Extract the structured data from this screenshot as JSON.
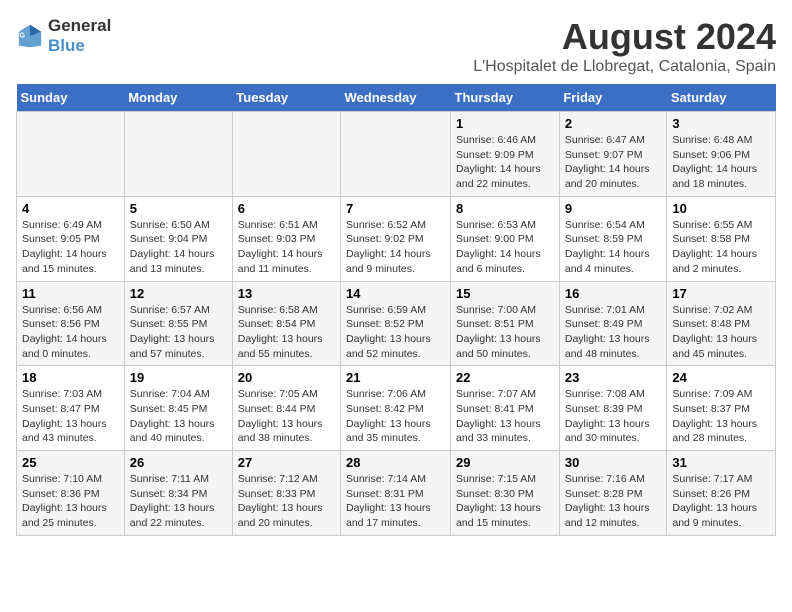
{
  "header": {
    "logo_line1": "General",
    "logo_line2": "Blue",
    "title": "August 2024",
    "subtitle": "L'Hospitalet de Llobregat, Catalonia, Spain"
  },
  "calendar": {
    "days_of_week": [
      "Sunday",
      "Monday",
      "Tuesday",
      "Wednesday",
      "Thursday",
      "Friday",
      "Saturday"
    ],
    "weeks": [
      [
        {
          "day": "",
          "info": ""
        },
        {
          "day": "",
          "info": ""
        },
        {
          "day": "",
          "info": ""
        },
        {
          "day": "",
          "info": ""
        },
        {
          "day": "1",
          "info": "Sunrise: 6:46 AM\nSunset: 9:09 PM\nDaylight: 14 hours and 22 minutes."
        },
        {
          "day": "2",
          "info": "Sunrise: 6:47 AM\nSunset: 9:07 PM\nDaylight: 14 hours and 20 minutes."
        },
        {
          "day": "3",
          "info": "Sunrise: 6:48 AM\nSunset: 9:06 PM\nDaylight: 14 hours and 18 minutes."
        }
      ],
      [
        {
          "day": "4",
          "info": "Sunrise: 6:49 AM\nSunset: 9:05 PM\nDaylight: 14 hours and 15 minutes."
        },
        {
          "day": "5",
          "info": "Sunrise: 6:50 AM\nSunset: 9:04 PM\nDaylight: 14 hours and 13 minutes."
        },
        {
          "day": "6",
          "info": "Sunrise: 6:51 AM\nSunset: 9:03 PM\nDaylight: 14 hours and 11 minutes."
        },
        {
          "day": "7",
          "info": "Sunrise: 6:52 AM\nSunset: 9:02 PM\nDaylight: 14 hours and 9 minutes."
        },
        {
          "day": "8",
          "info": "Sunrise: 6:53 AM\nSunset: 9:00 PM\nDaylight: 14 hours and 6 minutes."
        },
        {
          "day": "9",
          "info": "Sunrise: 6:54 AM\nSunset: 8:59 PM\nDaylight: 14 hours and 4 minutes."
        },
        {
          "day": "10",
          "info": "Sunrise: 6:55 AM\nSunset: 8:58 PM\nDaylight: 14 hours and 2 minutes."
        }
      ],
      [
        {
          "day": "11",
          "info": "Sunrise: 6:56 AM\nSunset: 8:56 PM\nDaylight: 14 hours and 0 minutes."
        },
        {
          "day": "12",
          "info": "Sunrise: 6:57 AM\nSunset: 8:55 PM\nDaylight: 13 hours and 57 minutes."
        },
        {
          "day": "13",
          "info": "Sunrise: 6:58 AM\nSunset: 8:54 PM\nDaylight: 13 hours and 55 minutes."
        },
        {
          "day": "14",
          "info": "Sunrise: 6:59 AM\nSunset: 8:52 PM\nDaylight: 13 hours and 52 minutes."
        },
        {
          "day": "15",
          "info": "Sunrise: 7:00 AM\nSunset: 8:51 PM\nDaylight: 13 hours and 50 minutes."
        },
        {
          "day": "16",
          "info": "Sunrise: 7:01 AM\nSunset: 8:49 PM\nDaylight: 13 hours and 48 minutes."
        },
        {
          "day": "17",
          "info": "Sunrise: 7:02 AM\nSunset: 8:48 PM\nDaylight: 13 hours and 45 minutes."
        }
      ],
      [
        {
          "day": "18",
          "info": "Sunrise: 7:03 AM\nSunset: 8:47 PM\nDaylight: 13 hours and 43 minutes."
        },
        {
          "day": "19",
          "info": "Sunrise: 7:04 AM\nSunset: 8:45 PM\nDaylight: 13 hours and 40 minutes."
        },
        {
          "day": "20",
          "info": "Sunrise: 7:05 AM\nSunset: 8:44 PM\nDaylight: 13 hours and 38 minutes."
        },
        {
          "day": "21",
          "info": "Sunrise: 7:06 AM\nSunset: 8:42 PM\nDaylight: 13 hours and 35 minutes."
        },
        {
          "day": "22",
          "info": "Sunrise: 7:07 AM\nSunset: 8:41 PM\nDaylight: 13 hours and 33 minutes."
        },
        {
          "day": "23",
          "info": "Sunrise: 7:08 AM\nSunset: 8:39 PM\nDaylight: 13 hours and 30 minutes."
        },
        {
          "day": "24",
          "info": "Sunrise: 7:09 AM\nSunset: 8:37 PM\nDaylight: 13 hours and 28 minutes."
        }
      ],
      [
        {
          "day": "25",
          "info": "Sunrise: 7:10 AM\nSunset: 8:36 PM\nDaylight: 13 hours and 25 minutes."
        },
        {
          "day": "26",
          "info": "Sunrise: 7:11 AM\nSunset: 8:34 PM\nDaylight: 13 hours and 22 minutes."
        },
        {
          "day": "27",
          "info": "Sunrise: 7:12 AM\nSunset: 8:33 PM\nDaylight: 13 hours and 20 minutes."
        },
        {
          "day": "28",
          "info": "Sunrise: 7:14 AM\nSunset: 8:31 PM\nDaylight: 13 hours and 17 minutes."
        },
        {
          "day": "29",
          "info": "Sunrise: 7:15 AM\nSunset: 8:30 PM\nDaylight: 13 hours and 15 minutes."
        },
        {
          "day": "30",
          "info": "Sunrise: 7:16 AM\nSunset: 8:28 PM\nDaylight: 13 hours and 12 minutes."
        },
        {
          "day": "31",
          "info": "Sunrise: 7:17 AM\nSunset: 8:26 PM\nDaylight: 13 hours and 9 minutes."
        }
      ]
    ]
  }
}
